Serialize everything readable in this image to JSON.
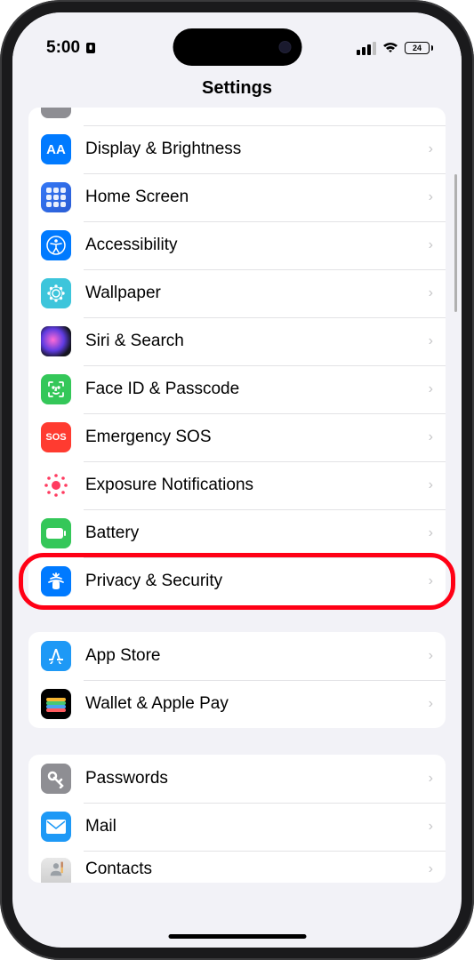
{
  "status": {
    "time": "5:00",
    "battery_percent": "24"
  },
  "page_title": "Settings",
  "sections": [
    {
      "items": [
        {
          "label": "Display & Brightness",
          "icon": "display-brightness-icon"
        },
        {
          "label": "Home Screen",
          "icon": "home-screen-icon"
        },
        {
          "label": "Accessibility",
          "icon": "accessibility-icon"
        },
        {
          "label": "Wallpaper",
          "icon": "wallpaper-icon"
        },
        {
          "label": "Siri & Search",
          "icon": "siri-icon"
        },
        {
          "label": "Face ID & Passcode",
          "icon": "face-id-icon"
        },
        {
          "label": "Emergency SOS",
          "icon": "sos-icon"
        },
        {
          "label": "Exposure Notifications",
          "icon": "exposure-icon"
        },
        {
          "label": "Battery",
          "icon": "battery-icon"
        },
        {
          "label": "Privacy & Security",
          "icon": "privacy-icon",
          "highlighted": true
        }
      ]
    },
    {
      "items": [
        {
          "label": "App Store",
          "icon": "app-store-icon"
        },
        {
          "label": "Wallet & Apple Pay",
          "icon": "wallet-icon"
        }
      ]
    },
    {
      "items": [
        {
          "label": "Passwords",
          "icon": "passwords-icon"
        },
        {
          "label": "Mail",
          "icon": "mail-icon"
        },
        {
          "label": "Contacts",
          "icon": "contacts-icon"
        }
      ]
    }
  ],
  "icons": {
    "display_text": "AA",
    "sos_text": "SOS"
  }
}
